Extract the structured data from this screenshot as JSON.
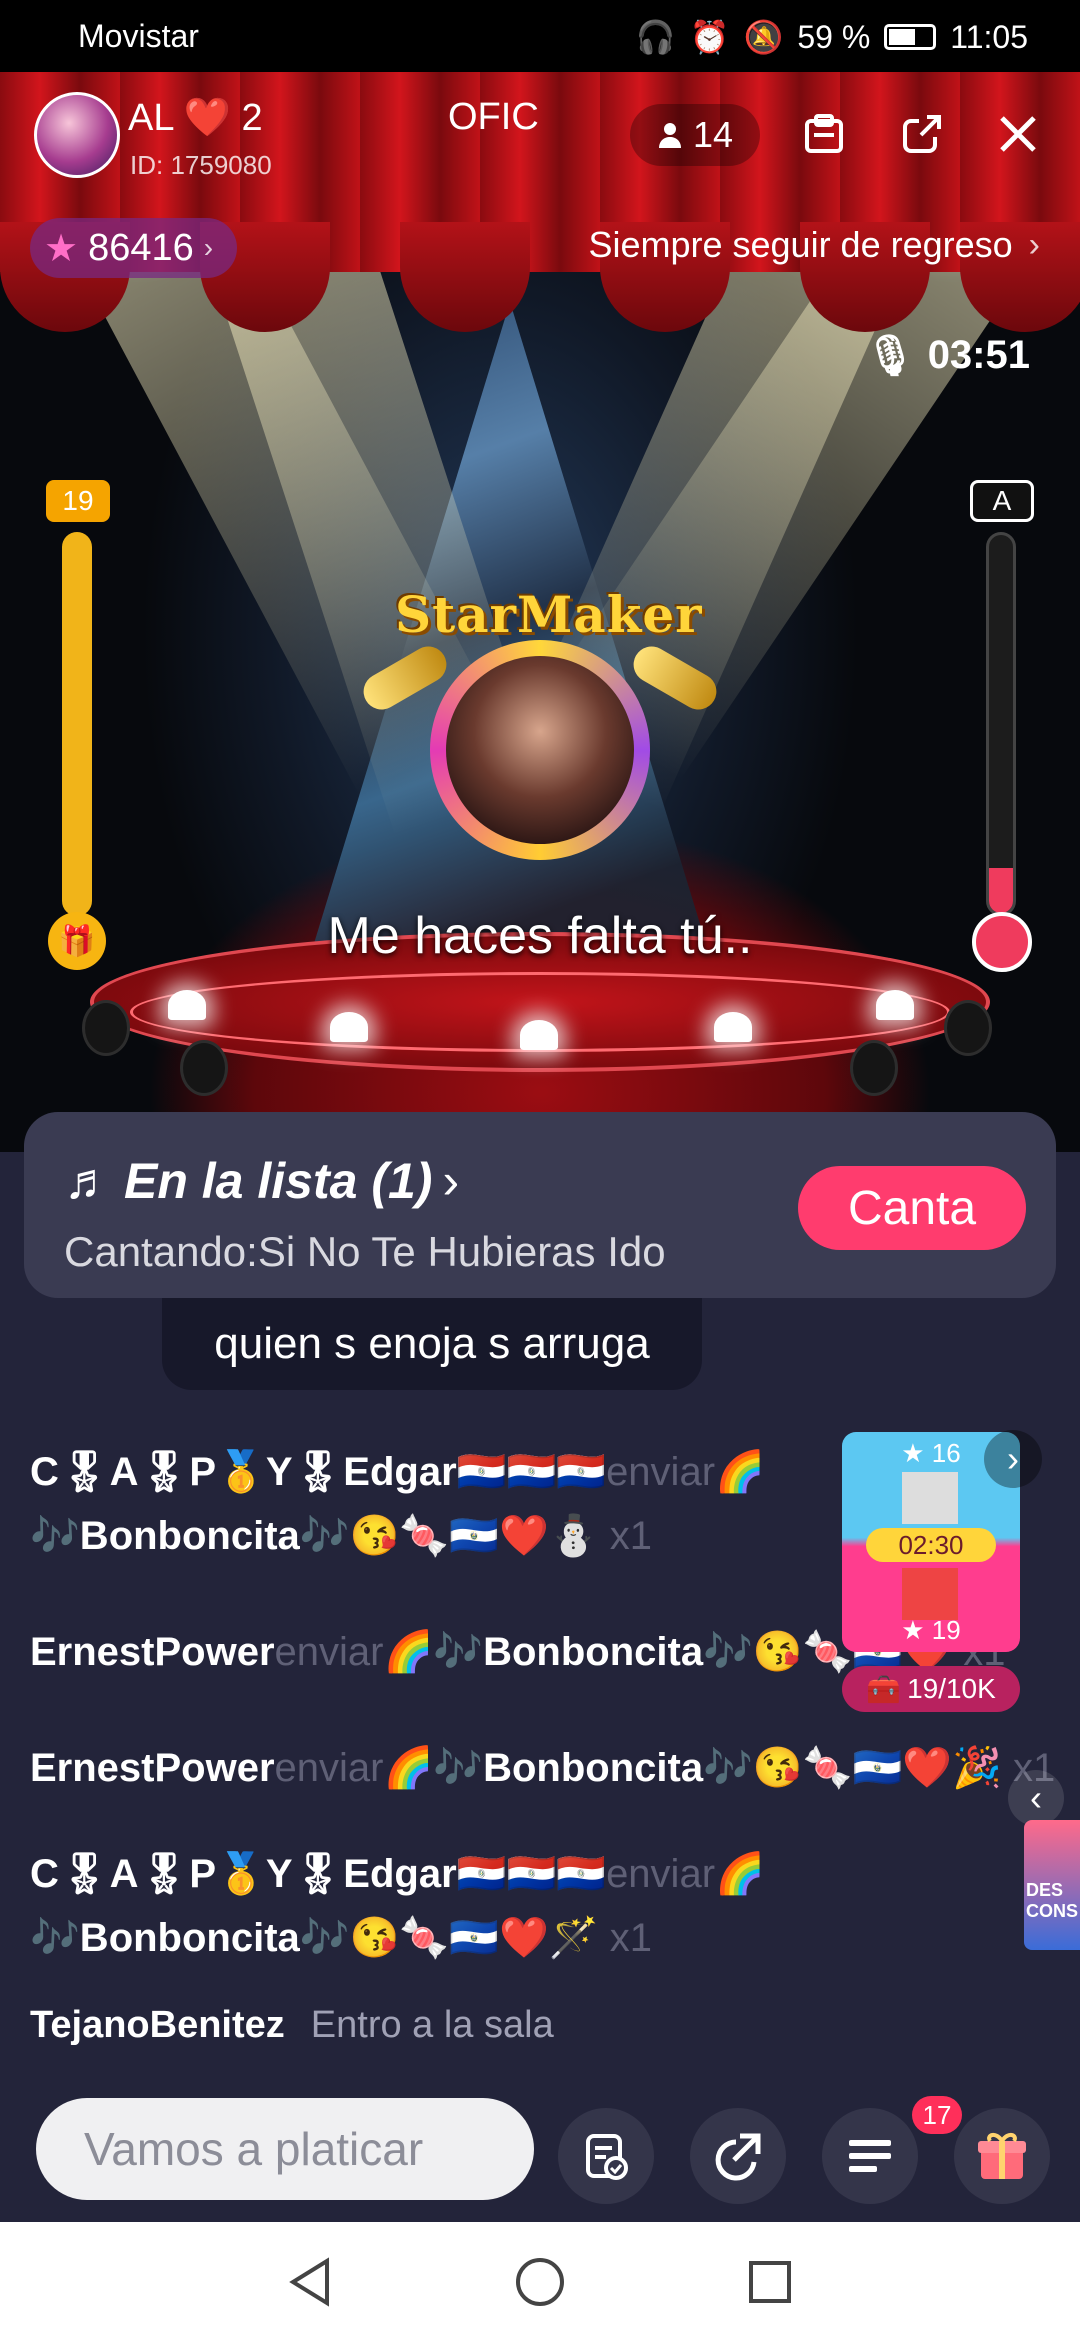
{
  "status_bar": {
    "carrier": "Movistar",
    "battery": "59 %",
    "time": "11:05"
  },
  "header": {
    "room_name": "\u0001 AL ❤️ 2",
    "room_name_suffix": "OFIC",
    "room_id": "ID: 1759080",
    "listeners": "14",
    "stars": "86416",
    "follow_text": "Siempre seguir de regreso"
  },
  "stage": {
    "timer": "03:51",
    "left_meter_value": "19",
    "right_meter_label": "A",
    "right_meter_level": 0.12,
    "brand": "StarMaker",
    "lyric": "Me haces falta tú.."
  },
  "queue": {
    "title": "En la lista (1)",
    "current": "Cantando:Si No Te Hubieras Ido",
    "sing_button": "Canta"
  },
  "chat": {
    "bubble_text": "quien s enoja s arruga",
    "messages": [
      {
        "name": "C🎖A🎖P🥇Y🎖Edgar🇵🇾🇵🇾🇵🇾",
        "verb": "enviar",
        "gift_line1": "🌈",
        "gift_line2": "🎶Bonboncita🎶😘🍬🇸🇻❤️⛄",
        "qty": "x1"
      },
      {
        "name": "ErnestPower",
        "verb": "enviar",
        "gift": "🌈🎶Bonboncita🎶😘🍬🇸🇻❤️",
        "qty": "x1"
      },
      {
        "name": "ErnestPower",
        "verb": "enviar",
        "gift": "🌈🎶Bonboncita🎶😘🍬🇸🇻❤️🎉",
        "qty": "x1"
      },
      {
        "name": "C🎖A🎖P🥇Y🎖Edgar🇵🇾🇵🇾🇵🇾",
        "verb": "enviar",
        "gift_line1": "🌈",
        "gift_line2": "🎶Bonboncita🎶😘🍬🇸🇻❤️🪄",
        "qty": "x1"
      }
    ],
    "enter": {
      "name": "TejanoBenitez",
      "message": "Entro a la sala"
    },
    "rank_card": {
      "top": "★ 16",
      "time": "02:30",
      "bottom": "★ 19"
    },
    "chest": "19/10K",
    "promo_text": "DES CONS"
  },
  "input_bar": {
    "placeholder": "Vamos a platicar",
    "menu_badge": "17"
  },
  "icons": {
    "listeners": "person-icon",
    "task": "clipboard-icon",
    "share": "share-icon",
    "close": "close-icon",
    "star": "star-icon",
    "timer": "microphone-icon",
    "gift": "gift-icon",
    "music": "music-list-icon"
  },
  "colors": {
    "accent": "#ff3c6e",
    "meter_left": "#f1b419",
    "meter_right": "#ef3b5d",
    "panel": "#3a3b52",
    "background": "#23243a"
  }
}
